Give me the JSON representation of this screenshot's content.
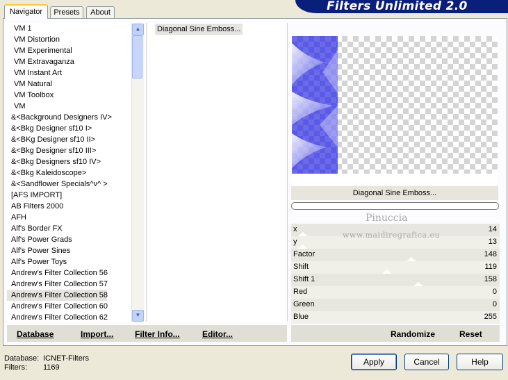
{
  "app": {
    "title": "Filters Unlimited 2.0"
  },
  "tabs": [
    {
      "label": "Navigator"
    },
    {
      "label": "Presets"
    },
    {
      "label": "About"
    }
  ],
  "categories": [
    {
      "label": "VM 1"
    },
    {
      "label": "VM Distortion"
    },
    {
      "label": "VM Experimental"
    },
    {
      "label": "VM Extravaganza"
    },
    {
      "label": "VM Instant Art"
    },
    {
      "label": "VM Natural"
    },
    {
      "label": "VM Toolbox"
    },
    {
      "label": "VM"
    },
    {
      "label": "&<Background Designers IV>"
    },
    {
      "label": "&<Bkg Designer sf10 I>"
    },
    {
      "label": "&<BKg Designer sf10 II>"
    },
    {
      "label": "&<Bkg Designer sf10 III>"
    },
    {
      "label": "&<Bkg Designers sf10 IV>"
    },
    {
      "label": "&<Bkg Kaleidoscope>"
    },
    {
      "label": "&<Sandflower Specials^v^ >"
    },
    {
      "label": "[AFS IMPORT]"
    },
    {
      "label": "AB Filters 2000"
    },
    {
      "label": "AFH"
    },
    {
      "label": "Alf's Border FX"
    },
    {
      "label": "Alf's Power Grads"
    },
    {
      "label": "Alf's Power Sines"
    },
    {
      "label": "Alf's Power Toys"
    },
    {
      "label": "Andrew's Filter Collection 56"
    },
    {
      "label": "Andrew's Filter Collection 57"
    },
    {
      "label": "Andrew's Filter Collection 58"
    },
    {
      "label": "Andrew's Filter Collection 60"
    },
    {
      "label": "Andrew's Filter Collection 62"
    }
  ],
  "selected_category": "Andrew's Filter Collection 58",
  "filters": [
    {
      "label": "Diagonal Sine Emboss..."
    }
  ],
  "preview": {
    "filter_name": "Diagonal Sine Emboss...",
    "accent_color": "#5858e8",
    "watermark_name": "Pinuccia",
    "watermark_url": "www.maidiregrafica.eu"
  },
  "params": [
    {
      "name": "x",
      "value": "14"
    },
    {
      "name": "y",
      "value": "13"
    },
    {
      "name": "Factor",
      "value": "148"
    },
    {
      "name": "Shift",
      "value": "119"
    },
    {
      "name": "Shift 1",
      "value": "158"
    },
    {
      "name": "Red",
      "value": "0"
    },
    {
      "name": "Green",
      "value": "0"
    },
    {
      "name": "Blue",
      "value": "255"
    }
  ],
  "toolbar": {
    "database": "Database",
    "import": "Import...",
    "filter_info": "Filter Info...",
    "editor": "Editor...",
    "randomize": "Randomize",
    "reset": "Reset"
  },
  "status": {
    "database_label": "Database:",
    "database_value": "ICNET-Filters",
    "filters_label": "Filters:",
    "filters_value": "1169"
  },
  "buttons": {
    "apply": "Apply",
    "cancel": "Cancel",
    "help": "Help"
  }
}
